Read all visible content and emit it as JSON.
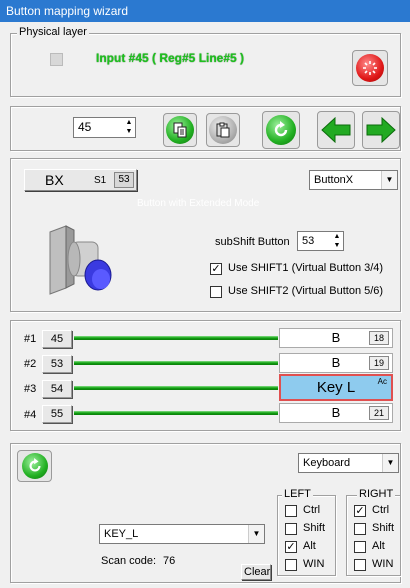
{
  "window": {
    "title": "Button mapping wizard"
  },
  "physical": {
    "legend": "Physical layer",
    "status": "Input #45  ( Reg#5  Line#5 )"
  },
  "nav": {
    "input_value": "45"
  },
  "button": {
    "name": "BX",
    "s_label": "S1",
    "s_value": "53",
    "type_value": "ButtonX",
    "mode_text": "Button with Extended Mode",
    "subshift_label": "subShift Button",
    "subshift_value": "53",
    "shift1_label": "Use SHIFT1 (Virtual Button 3/4)",
    "shift1_checked": true,
    "shift2_label": "Use SHIFT2 (Virtual Button 5/6)",
    "shift2_checked": false
  },
  "mapping_rows": [
    {
      "label": "#1",
      "num": "45",
      "target": "B",
      "badge": "18"
    },
    {
      "label": "#2",
      "num": "53",
      "target": "B",
      "badge": "19"
    },
    {
      "label": "#3",
      "num": "54",
      "target": "Key L",
      "badge": "Ac",
      "selected": true
    },
    {
      "label": "#4",
      "num": "55",
      "target": "B",
      "badge": "21"
    }
  ],
  "keyboard": {
    "device_value": "Keyboard",
    "key_value": "KEY_L",
    "scancode_label": "Scan code:",
    "scancode_value": "76",
    "clear_label": "Clear",
    "left_legend": "LEFT",
    "right_legend": "RIGHT",
    "left": [
      {
        "label": "Ctrl",
        "checked": false
      },
      {
        "label": "Shift",
        "checked": false
      },
      {
        "label": "Alt",
        "checked": true
      },
      {
        "label": "WIN",
        "checked": false
      }
    ],
    "right": [
      {
        "label": "Ctrl",
        "checked": true
      },
      {
        "label": "Shift",
        "checked": false
      },
      {
        "label": "Alt",
        "checked": false
      },
      {
        "label": "WIN",
        "checked": false
      }
    ]
  },
  "colors": {
    "titlebar": "#2b79d0",
    "status_green": "#1ec21e",
    "selected_fill": "#8ecbee",
    "selected_border": "#e05050",
    "green_line": "#10a010"
  }
}
